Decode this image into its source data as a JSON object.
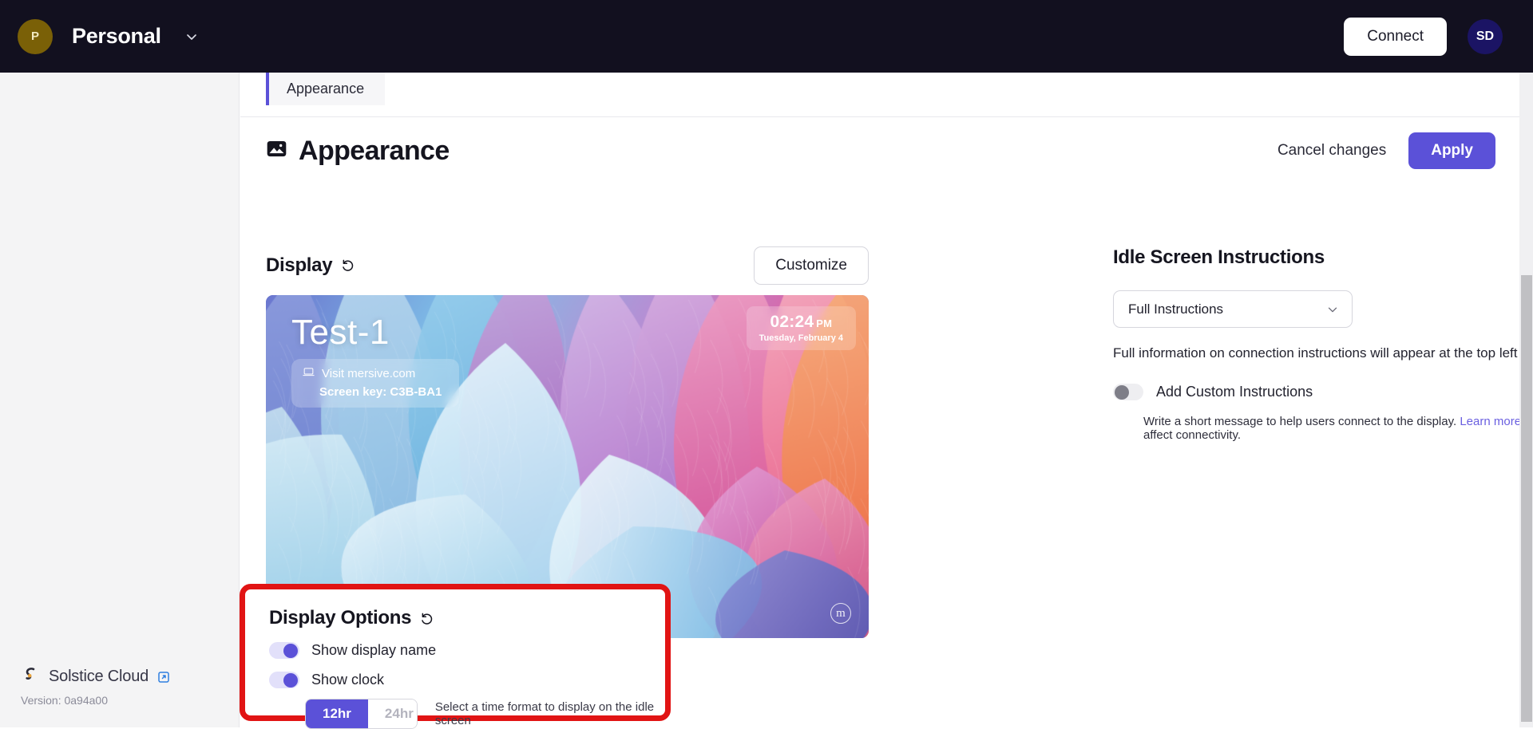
{
  "topbar": {
    "org_initial": "P",
    "org_name": "Personal",
    "caret_icon": "chevron-down-icon",
    "connect_label": "Connect",
    "user_initials": "SD"
  },
  "sidebar": {
    "product_name": "Solstice Cloud",
    "external_link_icon": "external-link-icon",
    "version": "Version: 0a94a00"
  },
  "tabs": [
    {
      "label": "Appearance",
      "active": true
    }
  ],
  "page": {
    "title": "Appearance",
    "title_icon": "image-icon",
    "cancel_label": "Cancel changes",
    "apply_label": "Apply"
  },
  "display_section": {
    "title": "Display",
    "reset_icon": "undo-reset-icon",
    "customize_label": "Customize",
    "preview": {
      "display_name": "Test-1",
      "visit_icon": "laptop-icon",
      "visit_text": "Visit mersive.com",
      "screen_key": "Screen key: C3B-BA1",
      "time": "02:24",
      "ampm": "PM",
      "date": "Tuesday, February 4",
      "watermark_icon": "mersive-logo-icon",
      "watermark_letter": "m"
    }
  },
  "display_options": {
    "title": "Display Options",
    "reset_icon": "undo-reset-icon",
    "highlight_color": "#e11414",
    "options": [
      {
        "label": "Show display name",
        "state": "on"
      },
      {
        "label": "Show clock",
        "state": "on"
      }
    ],
    "time_format": {
      "selected": "12hr",
      "choices": [
        "12hr",
        "24hr"
      ],
      "hint": "Select a time format to display on the idle screen"
    }
  },
  "idle_screen": {
    "title": "Idle Screen Instructions",
    "select_value": "Full Instructions",
    "select_caret_icon": "chevron-down-icon",
    "description": "Full information on connection instructions will appear at the top left of the display.",
    "custom_toggle": {
      "label": "Add Custom Instructions",
      "state": "off"
    },
    "sub_desc_before": "Write a short message to help users connect to the display. ",
    "sub_desc_link": "Learn more",
    "sub_desc_after": " about how your network can affect connectivity."
  },
  "theme": {
    "accent": "#5b51d8",
    "topbar_bg": "#12101f",
    "sidebar_bg": "#f4f4f5",
    "link": "#6a5fe0"
  }
}
